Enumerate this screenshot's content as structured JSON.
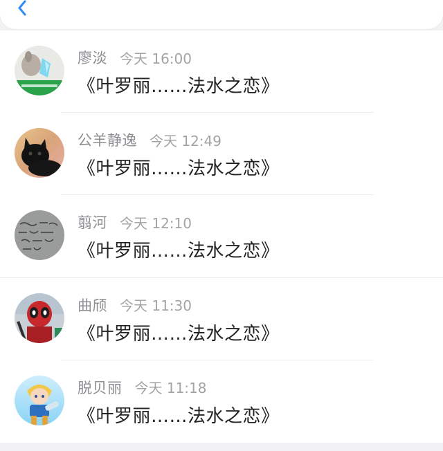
{
  "header": {
    "back_icon": "chevron-left-icon",
    "accent": "#2f8cf6"
  },
  "messages": [
    {
      "name": "廖淡",
      "time": "今天 16:00",
      "text": "《叶罗丽……法水之恋》",
      "avatar_icon": "avatar-cat-photo"
    },
    {
      "name": "公羊静逸",
      "time": "今天 12:49",
      "text": "《叶罗丽……法水之恋》",
      "avatar_icon": "avatar-black-kitten"
    },
    {
      "name": "翦河",
      "time": "今天 12:10",
      "text": "《叶罗丽……法水之恋》",
      "avatar_icon": "avatar-handwriting"
    },
    {
      "name": "曲颀",
      "time": "今天 11:30",
      "text": "《叶罗丽……法水之恋》",
      "avatar_icon": "avatar-deadpool-figure"
    },
    {
      "name": "脱贝丽",
      "time": "今天 11:18",
      "text": "《叶罗丽……法水之恋》",
      "avatar_icon": "avatar-anime-character"
    }
  ]
}
